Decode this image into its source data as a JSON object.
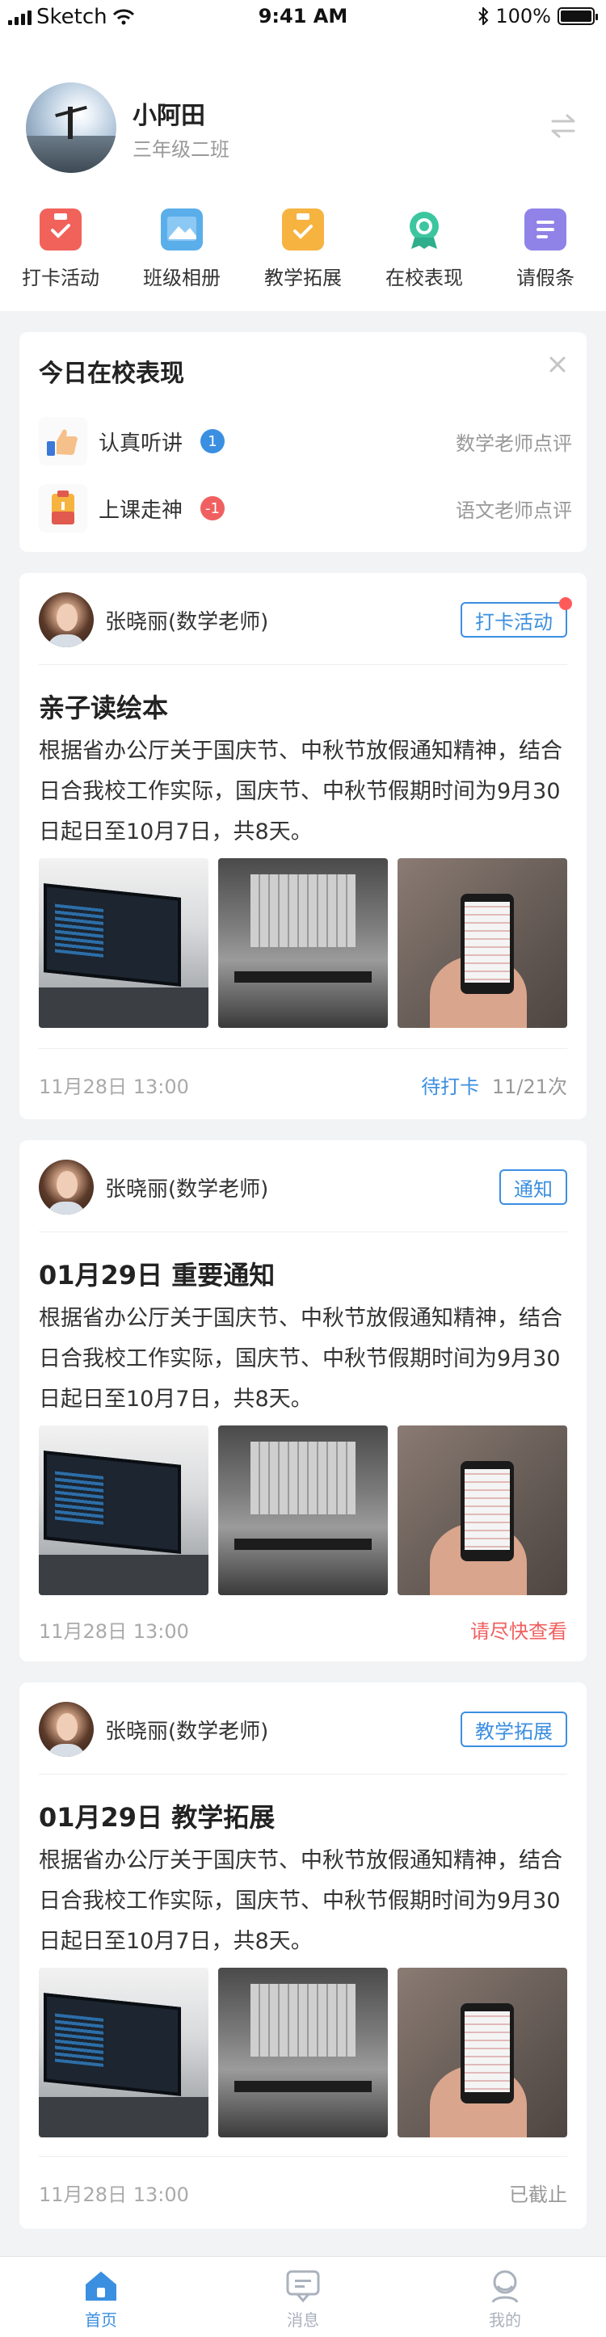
{
  "status_bar": {
    "carrier": "Sketch",
    "time": "9:41 AM",
    "battery": "100%"
  },
  "profile": {
    "name": "小阿田",
    "class_name": "三年级二班"
  },
  "menu": [
    {
      "label": "打卡活动",
      "icon": "clipboard-check-icon",
      "color": "#f0625a"
    },
    {
      "label": "班级相册",
      "icon": "photo-album-icon",
      "color": "#5aaeea"
    },
    {
      "label": "教学拓展",
      "icon": "task-check-icon",
      "color": "#f6b33f"
    },
    {
      "label": "在校表现",
      "icon": "medal-icon",
      "color": "#3cc6a0"
    },
    {
      "label": "请假条",
      "icon": "document-icon",
      "color": "#8f83e8"
    }
  ],
  "today": {
    "title": "今日在校表现",
    "items": [
      {
        "label": "认真听讲",
        "badge": "1",
        "badge_color": "#3b8fe0",
        "note": "数学老师点评",
        "icon": "thumbs-up-icon"
      },
      {
        "label": "上课走神",
        "badge": "-1",
        "badge_color": "#f06060",
        "note": "语文老师点评",
        "icon": "warning-clipboard-icon"
      }
    ]
  },
  "posts": [
    {
      "author": "张晓丽(数学老师)",
      "tag": "打卡活动",
      "title": "亲子读绘本",
      "body": "根据省办公厅关于国庆节、中秋节放假通知精神，结合日合我校工作实际，国庆节、中秋节假期时间为9月30日起日至10月7日，共8天。",
      "time": "11月28日 13:00",
      "status": "待打卡",
      "status_extra": "11/21次",
      "status_color": "#3b8fe0"
    },
    {
      "author": "张晓丽(数学老师)",
      "tag": "通知",
      "title": "01月29日 重要通知",
      "body": "根据省办公厅关于国庆节、中秋节放假通知精神，结合日合我校工作实际，国庆节、中秋节假期时间为9月30日起日至10月7日，共8天。",
      "time": "11月28日 13:00",
      "status": "请尽快查看",
      "status_color": "#f06060"
    },
    {
      "author": "张晓丽(数学老师)",
      "tag": "教学拓展",
      "title": "01月29日 教学拓展",
      "body": "根据省办公厅关于国庆节、中秋节放假通知精神，结合日合我校工作实际，国庆节、中秋节假期时间为9月30日起日至10月7日，共8天。",
      "time": "11月28日 13:00",
      "status": "已截止",
      "status_color": "#999999"
    }
  ],
  "tabbar": [
    {
      "label": "首页",
      "icon": "home-icon",
      "active": true
    },
    {
      "label": "消息",
      "icon": "message-icon",
      "active": false
    },
    {
      "label": "我的",
      "icon": "profile-icon",
      "active": false
    }
  ]
}
